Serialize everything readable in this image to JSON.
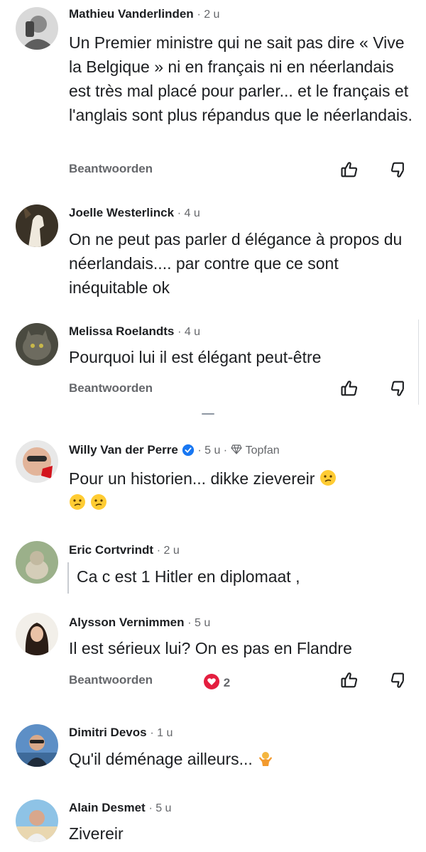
{
  "comments": [
    {
      "name": "Mathieu Vanderlinden",
      "time": "· 2 u",
      "text": "Un Premier ministre qui ne sait pas dire « Vive la Belgique » ni en français ni en néerlandais est très mal placé pour parler... et le français et l'anglais sont plus répandus que le néerlandais.",
      "reply": "Beantwoorden"
    },
    {
      "name": "Joelle Westerlinck",
      "time": "· 4 u",
      "text": "On ne peut pas parler d élégance à propos du néerlandais.... par contre que ce sont inéquitable ok"
    },
    {
      "name": "Melissa Roelandts",
      "time": "· 4 u",
      "text": "Pourquoi lui il est élégant peut-être",
      "reply": "Beantwoorden"
    },
    {
      "name": "Willy Van der Perre",
      "time": "· 5 u ·",
      "badge": "Topfan",
      "text": "Pour un historien... dikke zievereir"
    },
    {
      "name": "Eric Cortvrindt",
      "time": "· 2 u",
      "text": "Ca c est 1 Hitler en diplomaat ,"
    },
    {
      "name": "Alysson Vernimmen",
      "time": "· 5 u",
      "text": "Il est sérieux lui? On es pas en Flandre",
      "reply": "Beantwoorden",
      "reaction_count": "2"
    },
    {
      "name": "Dimitri Devos",
      "time": "· 1 u",
      "text": "Qu'il déménage ailleurs..."
    },
    {
      "name": "Alain Desmet",
      "time": "· 5 u",
      "text": "Zivereir"
    }
  ],
  "icons": {
    "like": "thumbs-up-icon",
    "dislike": "thumbs-down-icon",
    "verified": "verified-badge-icon",
    "topfan": "diamond-icon",
    "reaction": "heart-reaction-icon"
  },
  "colors": {
    "verified": "#1877f2",
    "reaction": "#e41e3f",
    "meta": "#65676b"
  }
}
